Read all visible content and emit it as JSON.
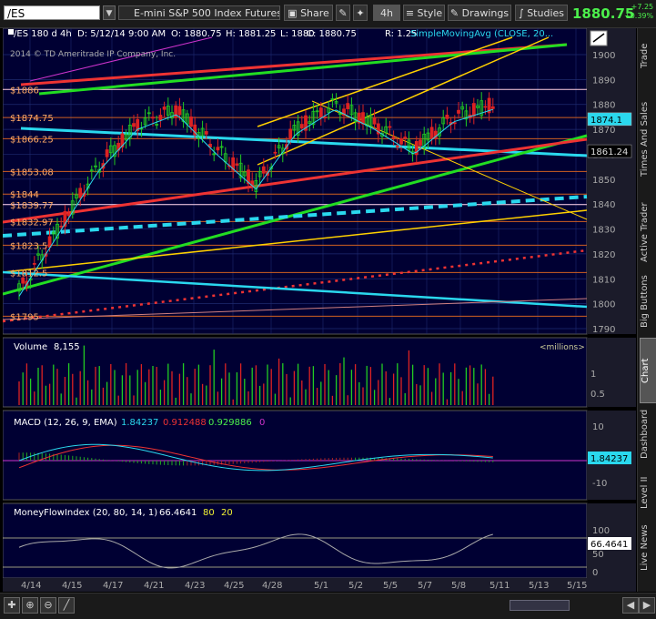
{
  "toolbar": {
    "symbol": "/ES",
    "description": "E-mini S&P 500 Index Futures,ET...",
    "share_label": "Share",
    "aggregation": "4h",
    "style_label": "Style",
    "drawings_label": "Drawings",
    "studies_label": "Studies",
    "last_price": "1880.75",
    "net_change": "+7.25",
    "pct_change": "+0.39%"
  },
  "header": {
    "symbol_period": "/ES 180 d 4h",
    "date": "D: 5/12/14 9:00 AM",
    "open": "O: 1880.75",
    "high": "H: 1881.25",
    "low": "L: 1880",
    "close": "C: 1880.75",
    "range": "R: 1.25",
    "study": "SimpleMovingAvg (CLOSE, 20...",
    "copyright": "2014 © TD Ameritrade IP Company, Inc."
  },
  "price_axis_labels": [
    "1900",
    "1890",
    "1880",
    "1870",
    "1860",
    "1850",
    "1840",
    "1830",
    "1820",
    "1810",
    "1800",
    "1790"
  ],
  "price_markers": [
    {
      "text": "1874.1",
      "bg": "#2ad8ee",
      "fg": "#000000"
    },
    {
      "text": "1861.24",
      "bg": "#000000",
      "fg": "#dddddd"
    }
  ],
  "level_labels": [
    "$1886",
    "$1874.75",
    "$1866.25",
    "$1853.08",
    "$1844",
    "$1839.77",
    "$1832.97",
    "$1823.5",
    "$1812.5",
    "$1795"
  ],
  "volume": {
    "title": "Volume",
    "value": "8,155",
    "unit": "<millions>",
    "axis": [
      "1",
      "0.5"
    ]
  },
  "macd": {
    "title": "MACD (12, 26, 9, EMA)",
    "value": "1.84237",
    "avg": "0.912488",
    "diff": "0.929886",
    "zero": "0",
    "axis": [
      "10",
      "0",
      "-10"
    ],
    "marker": "1.84237"
  },
  "mfi": {
    "title": "MoneyFlowIndex (20, 80, 14, 1)",
    "value": "66.4641",
    "ob": "80",
    "os": "20",
    "axis": [
      "100",
      "50",
      "0"
    ],
    "marker": "66.4641"
  },
  "x_dates": [
    "4/14",
    "4/15",
    "4/17",
    "4/21",
    "4/23",
    "4/25",
    "4/28",
    "5/1",
    "5/2",
    "5/5",
    "5/7",
    "5/8",
    "5/11",
    "5/13",
    "5/15"
  ],
  "right_tabs": [
    "Trade",
    "Times And Sales",
    "Active Trader",
    "Big Buttons",
    "Chart",
    "Dashboard",
    "Level II",
    "Live News"
  ],
  "active_tab": "Chart",
  "colors": {
    "bg": "#000033",
    "grid": "#202060",
    "up": "#22cc22",
    "down": "#dd2222"
  },
  "chart_data": {
    "type": "line",
    "title": "/ES 180 d 4h",
    "ylim": [
      1790,
      1905
    ],
    "x": [
      "4/14",
      "4/15",
      "4/17",
      "4/21",
      "4/23",
      "4/25",
      "4/28",
      "5/1",
      "5/2",
      "5/5",
      "5/7",
      "5/8",
      "5/11"
    ],
    "series": [
      {
        "name": "",
        "values": [
          1805,
          1830,
          1855,
          1872,
          1878,
          1862,
          1848,
          1870,
          1880,
          1872,
          1862,
          1875,
          1880
        ]
      }
    ],
    "levels": [
      1886,
      1874.75,
      1866.25,
      1853.08,
      1844,
      1839.77,
      1832.97,
      1823.5,
      1812.5,
      1795
    ]
  }
}
